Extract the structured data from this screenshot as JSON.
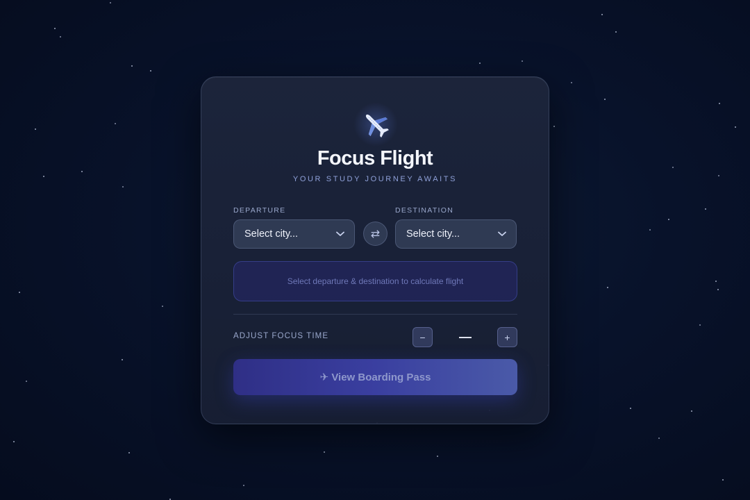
{
  "app": {
    "title": "Focus Flight",
    "subtitle": "YOUR STUDY JOURNEY AWAITS"
  },
  "route": {
    "departure": {
      "label": "DEPARTURE",
      "placeholder": "Select city..."
    },
    "destination": {
      "label": "DESTINATION",
      "placeholder": "Select city..."
    },
    "swap_icon": "⇄"
  },
  "info": {
    "message": "Select departure & destination to calculate flight"
  },
  "focus_time": {
    "label": "ADJUST FOCUS TIME",
    "decrement": "−",
    "increment": "+",
    "value": "—"
  },
  "cta": {
    "label": "✈ View Boarding Pass"
  },
  "colors": {
    "accent": "#3a3fa0",
    "background": "#08122a",
    "card": "#1e263c"
  }
}
